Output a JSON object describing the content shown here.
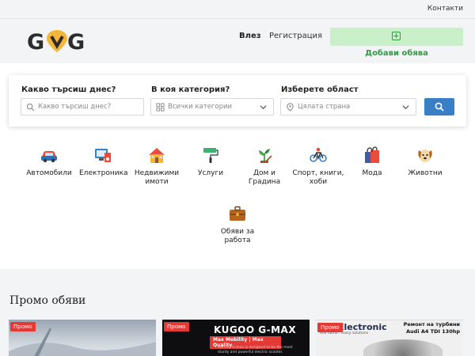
{
  "topbar": {
    "contacts": "Контакти"
  },
  "header": {
    "logo": "GVG",
    "login": "Влез",
    "register": "Регистрация",
    "add_button": "Добави обява"
  },
  "search": {
    "what_label": "Какво търсиш днес?",
    "what_placeholder": "Какво търсиш днес?",
    "category_label": "В коя категория?",
    "category_value": "Всички категории",
    "region_label": "Изберете област",
    "region_value": "Цялата страна"
  },
  "categories": [
    {
      "label": "Автомобили",
      "icon": "car-icon"
    },
    {
      "label": "Електроника",
      "icon": "electronics-icon"
    },
    {
      "label": "Недвижими имоти",
      "icon": "house-icon"
    },
    {
      "label": "Услуги",
      "icon": "paint-roller-icon"
    },
    {
      "label": "Дом и Градина",
      "icon": "plant-icon"
    },
    {
      "label": "Спорт, книги, хоби",
      "icon": "bicycle-icon"
    },
    {
      "label": "Мода",
      "icon": "shopping-bag-icon"
    },
    {
      "label": "Животни",
      "icon": "dog-icon"
    },
    {
      "label": "Обяви за работа",
      "icon": "briefcase-icon"
    }
  ],
  "promo": {
    "title": "Промо обяви",
    "badge": "Промо",
    "cards": [
      {
        "image": "landscape-photo"
      },
      {
        "headline": "KUGOO G-MAX",
        "tagline": "Max Mobility | Max Quality",
        "text": "KUGOO G-max is designed to be the most sturdy and powerful electric scooter."
      },
      {
        "brand": "Electronic",
        "subtitle": "one name...many solutions",
        "right1": "Ремонт на турбини",
        "right2": "Audi A4 TDI 130hp"
      }
    ]
  },
  "colors": {
    "accent": "#3a7ec5",
    "add_button_bg": "#c9f0c9",
    "add_button_text": "#2e9d3f",
    "promo_badge": "#e53935"
  }
}
